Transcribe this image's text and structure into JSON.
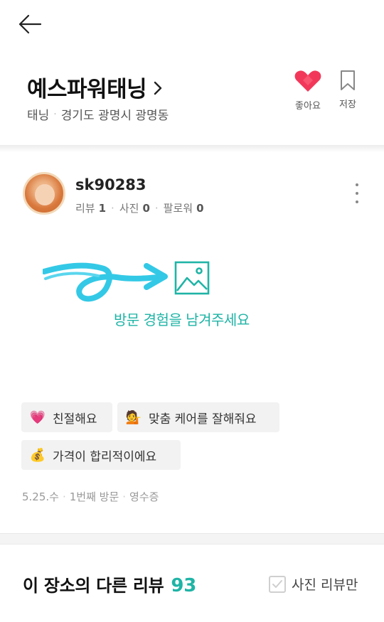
{
  "place": {
    "name": "예스파워태닝",
    "category": "태닝",
    "location": "경기도 광명시 광명동",
    "like_label": "좋아요",
    "save_label": "저장",
    "like_color": "#f2385a"
  },
  "review": {
    "user": {
      "name": "sk90283",
      "reviews_label": "리뷰",
      "reviews_count": "1",
      "photos_label": "사진",
      "photos_count": "0",
      "followers_label": "팔로워",
      "followers_count": "0"
    },
    "placeholder_text": "방문 경험을 남겨주세요",
    "accent_color": "#1fb4a6",
    "tags": [
      {
        "emoji": "💗",
        "icon": "heart-emoji-icon",
        "label": "친절해요"
      },
      {
        "emoji": "💁",
        "icon": "person-emoji-icon",
        "label": "맞춤 케어를 잘해줘요"
      },
      {
        "emoji": "💰",
        "icon": "money-emoji-icon",
        "label": "가격이 합리적이에요"
      }
    ],
    "visit": {
      "date": "5.25.수",
      "visit_count": "1번째 방문",
      "verification": "영수증"
    }
  },
  "other_reviews": {
    "title": "이 장소의 다른 리뷰",
    "count": "93",
    "photo_only_label": "사진 리뷰만"
  }
}
